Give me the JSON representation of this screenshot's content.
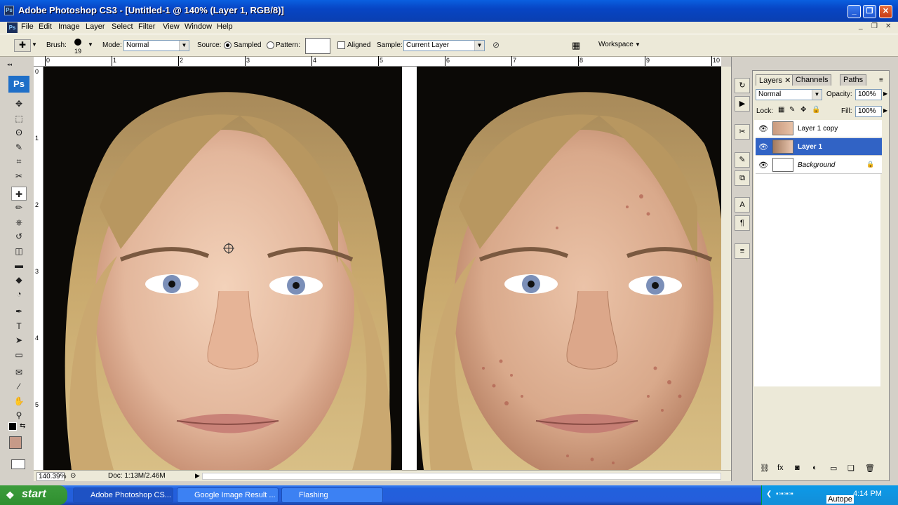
{
  "titlebar": {
    "title": "Adobe Photoshop CS3 - [Untitled-1 @ 140% (Layer 1, RGB/8)]",
    "app_icon": "Ps",
    "min_label": "_",
    "max_label": "❐",
    "close_label": "✕"
  },
  "menu": {
    "logo": "Ps",
    "items": [
      "File",
      "Edit",
      "Image",
      "Layer",
      "Select",
      "Filter",
      "View",
      "Window",
      "Help"
    ],
    "doc_controls": [
      "_",
      "❐",
      "✕"
    ]
  },
  "options": {
    "brush_label": "Brush:",
    "brush_size": "19",
    "mode_label": "Mode:",
    "mode_value": "Normal",
    "source_label": "Source:",
    "sampled_label": "Sampled",
    "pattern_label": "Pattern:",
    "aligned_label": "Aligned",
    "sample_label": "Sample:",
    "sample_value": "Current Layer",
    "workspace_label": "Workspace"
  },
  "toolbox": {
    "logo": "Ps",
    "tools": [
      "move-tool",
      "marquee-tool",
      "lasso-tool",
      "quick-select-tool",
      "crop-tool",
      "slice-tool",
      "healing-brush-tool",
      "brush-tool",
      "clone-stamp-tool",
      "history-brush-tool",
      "eraser-tool",
      "gradient-tool",
      "blur-tool",
      "dodge-tool",
      "pen-tool",
      "type-tool",
      "path-select-tool",
      "shape-tool",
      "notes-tool",
      "eyedropper-tool",
      "hand-tool",
      "zoom-tool"
    ],
    "tool_glyphs": [
      "✥",
      "⬚",
      "ʘ",
      "✎",
      "⌗",
      "✂",
      "✚",
      "✏",
      "⎈",
      "↺",
      "◫",
      "▬",
      "◆",
      "◔",
      "✒",
      "T",
      "➤",
      "▭",
      "✉",
      "⁄",
      "✋",
      "⚲"
    ],
    "fg_color": "#c69a88"
  },
  "rulers": {
    "top": [
      "0",
      "1",
      "2",
      "3",
      "4",
      "5",
      "6",
      "7",
      "8",
      "9",
      "10"
    ],
    "left": [
      "0",
      "1",
      "2",
      "3",
      "4",
      "5"
    ]
  },
  "status": {
    "zoom": "140.39%",
    "doc": "Doc: 1:13M/2.46M"
  },
  "dock_icons": [
    "history-icon",
    "actions-icon",
    "tools-icon",
    "brushes-icon",
    "clone-source-icon",
    "character-icon",
    "paragraph-icon",
    "layer-comps-icon"
  ],
  "dock_glyphs": [
    "↻",
    "▶",
    "✂",
    "✎",
    "⧉",
    "A",
    "¶",
    "≡"
  ],
  "layers_panel": {
    "tabs": [
      "Layers",
      "Channels",
      "Paths"
    ],
    "blend_mode": "Normal",
    "opacity_label": "Opacity:",
    "opacity_value": "100%",
    "lock_label": "Lock:",
    "fill_label": "Fill:",
    "fill_value": "100%",
    "layers": [
      {
        "name": "Layer 1 copy",
        "selected": false
      },
      {
        "name": "Layer 1",
        "selected": true
      },
      {
        "name": "Background",
        "selected": false
      }
    ],
    "bottom_icons": [
      "link-icon",
      "fx-icon",
      "mask-icon",
      "adjustment-icon",
      "folder-icon",
      "new-layer-icon",
      "trash-icon"
    ],
    "bottom_glyphs": [
      "⛓",
      "fx",
      "◙",
      "◐",
      "▭",
      "❏",
      "🗑"
    ]
  },
  "taskbar": {
    "start": "start",
    "tasks": [
      {
        "label": "Adobe Photoshop CS...",
        "active": true
      },
      {
        "label": "Google Image Result ...",
        "active": false
      },
      {
        "label": "Flashing",
        "active": false
      }
    ],
    "time": "4:14 PM",
    "tray_label": "Autope"
  }
}
